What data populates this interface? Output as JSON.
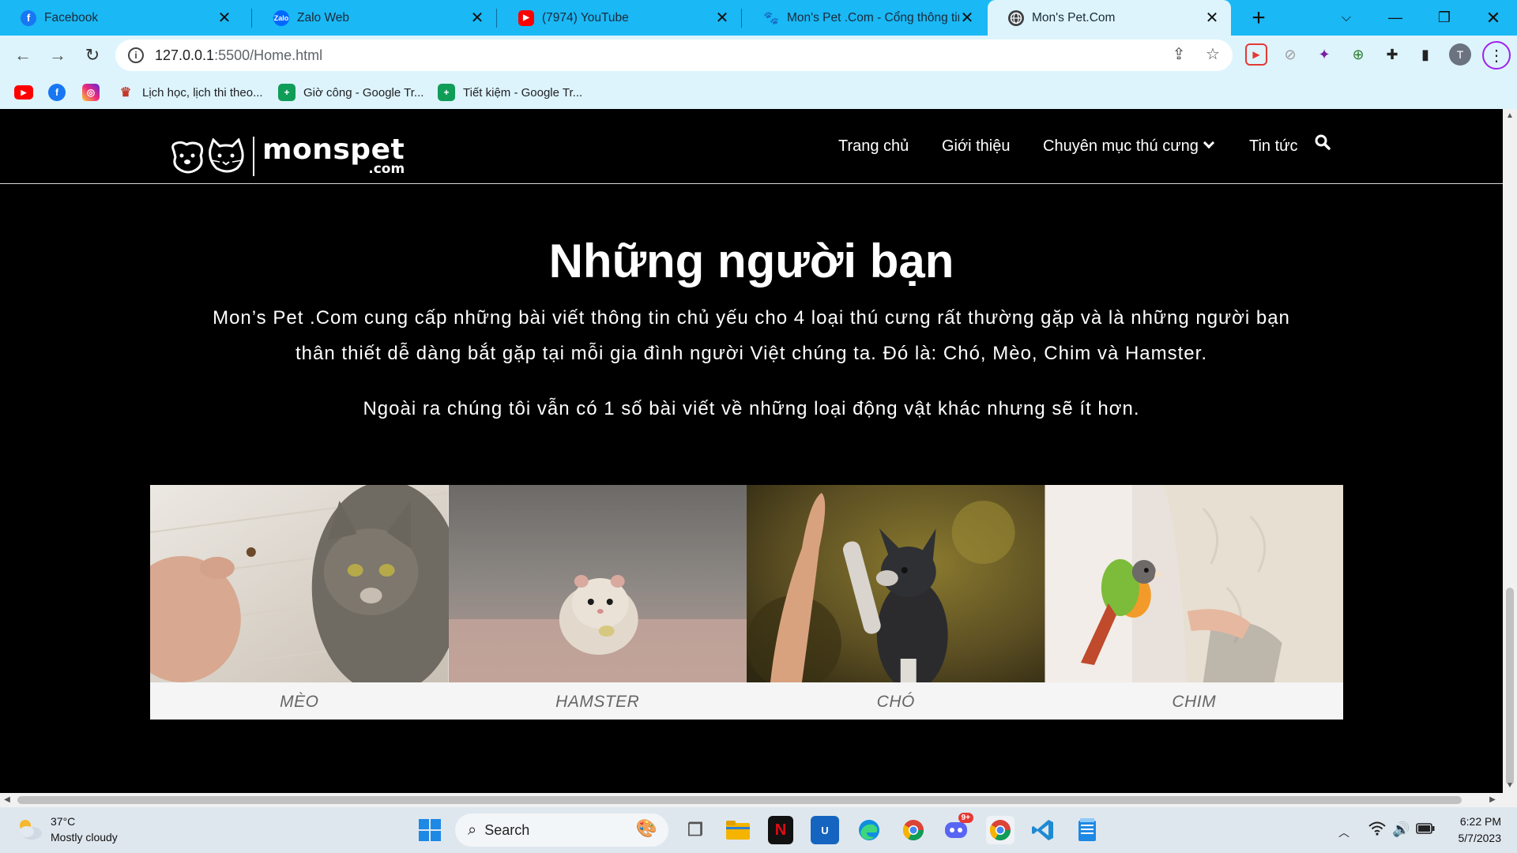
{
  "browser": {
    "tabs": [
      {
        "label": "Facebook",
        "icon": "facebook-icon",
        "color": "#1877f2",
        "glyph": "f"
      },
      {
        "label": "Zalo Web",
        "icon": "zalo-icon",
        "color": "#0068ff",
        "glyph": "Z"
      },
      {
        "label": "(7974) YouTube",
        "icon": "youtube-icon",
        "color": "#ff0000",
        "glyph": "▶"
      },
      {
        "label": "Mon's Pet .Com - Cổng thông tin",
        "icon": "paw-icon",
        "color": "#222222",
        "glyph": "🐾"
      },
      {
        "label": "Mon's Pet.Com",
        "icon": "globe-icon",
        "color": "#5f6368",
        "glyph": "🌐"
      }
    ],
    "url_host": "127.0.0.1",
    "url_rest": ":5500/Home.html",
    "profile_initial": "T",
    "bookmarks": [
      {
        "label": "",
        "icon": "youtube-icon",
        "color": "#ff0000",
        "glyph": "▶"
      },
      {
        "label": "",
        "icon": "facebook-icon",
        "color": "#1877f2",
        "glyph": "f"
      },
      {
        "label": "",
        "icon": "instagram-icon",
        "color": "#d6249f",
        "glyph": "◎"
      },
      {
        "label": "Lịch học, lịch thi theo...",
        "icon": "school-icon",
        "color": "#c0392b",
        "glyph": "✎"
      },
      {
        "label": "Giờ công - Google Tr...",
        "icon": "sheets-icon",
        "color": "#0f9d58",
        "glyph": "+"
      },
      {
        "label": "Tiết kiệm - Google Tr...",
        "icon": "sheets-icon",
        "color": "#0f9d58",
        "glyph": "+"
      }
    ]
  },
  "site": {
    "logo_main": "monspet",
    "logo_sub": ".com",
    "nav": [
      "Trang chủ",
      "Giới thiệu",
      "Chuyên mục thú cưng",
      "Tin tức"
    ],
    "section_title": "Những người bạn",
    "paragraph1_line1": "Mon’s Pet .Com cung cấp những bài viết thông tin chủ yếu cho 4 loại thú cưng rất thường gặp và là những người bạn",
    "paragraph1_line2": "thân thiết dễ dàng bắt gặp tại mỗi gia đình người Việt chúng ta. Đó là: Chó, Mèo, Chim và Hamster.",
    "paragraph2": "Ngoài ra chúng tôi vẫn có 1 số bài viết về những loại động vật khác nhưng sẽ ít hơn.",
    "cards": [
      "MÈO",
      "HAMSTER",
      "CHÓ",
      "CHIM"
    ]
  },
  "taskbar": {
    "temperature": "37°C",
    "weather": "Mostly cloudy",
    "search_label": "Search",
    "time": "6:22 PM",
    "date": "5/7/2023",
    "discord_badge": "9+"
  }
}
